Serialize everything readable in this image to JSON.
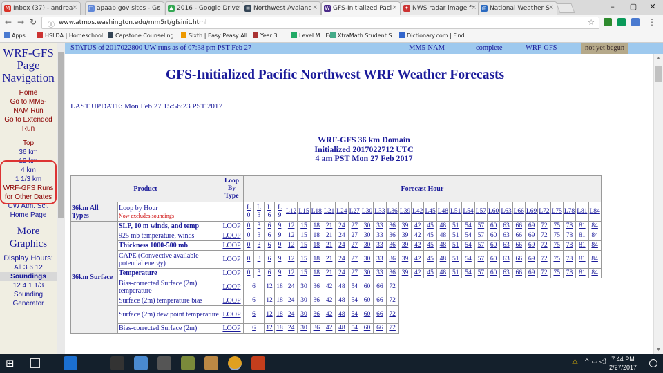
{
  "browser": {
    "tabs": [
      {
        "title": "Inbox (37) - andrea",
        "color": "#d93025",
        "glyph": "M"
      },
      {
        "title": "apaap gov sites - Go",
        "color": "#5f87d8",
        "glyph": "▢"
      },
      {
        "title": "2016 - Google Drive",
        "color": "#34a853",
        "glyph": "▲"
      },
      {
        "title": "Northwest Avalanc",
        "color": "#345",
        "glyph": "≡"
      },
      {
        "title": "GFS-Initialized Paci",
        "color": "#4a2a8a",
        "glyph": "W"
      },
      {
        "title": "NWS radar image fr",
        "color": "#c33",
        "glyph": "✦"
      },
      {
        "title": "National Weather S",
        "color": "#2a6ac0",
        "glyph": "◎"
      }
    ],
    "url": "www.atmos.washington.edu/mm5rt/gfsinit.html",
    "bookmarks": [
      "Apps",
      "HSLDA | Homeschool",
      "Capstone Counseling",
      "Sixth | Easy Peasy All",
      "Year 3",
      "Level M | Ea",
      "XtraMath  Student S",
      "Dictionary.com | Find"
    ]
  },
  "left_nav": {
    "title": "WRF-GFS Page Navigation",
    "home": "Home",
    "go_mm5": "Go to MM5-NAM Run",
    "go_extended": "Go to Extended Run",
    "top": "Top",
    "res_36": "36 km",
    "res_12": "12 km",
    "res_4": "4 km",
    "res_1": "1 1/3 km",
    "wrf_runs": "WRF-GFS Runs for Other Dates",
    "uw": "UW Atm. Sci. Home Page",
    "more_graphics": "More Graphics",
    "display_hours": "Display Hours:",
    "hours_line": "All  3  6  12",
    "soundings": "Soundings",
    "soundings_line": "12  4    1 1/3",
    "sounding_gen": "Sounding Generator"
  },
  "status": {
    "text": "STATUS of 2017022800 UW runs as of 07:38 pm PST Feb 27",
    "model1": "MM5-NAM",
    "state1": "complete",
    "model2": "WRF-GFS",
    "state2": "not yet begun"
  },
  "page_title": "GFS-Initialized Pacific Northwest WRF Weather Forecasts",
  "last_update": "LAST UPDATE: Mon Feb 27 15:56:23 PST 2017",
  "domain_header": {
    "line1": "WRF-GFS 36 km Domain",
    "line2": "Initialized 2017022712 UTC",
    "line3": "4 am PST Mon 27 Feb 2017"
  },
  "table": {
    "headers": {
      "product": "Product",
      "loop": "Loop By Type",
      "forecast": "Forecast Hour"
    },
    "loop_row": {
      "label": "36km All Types",
      "product": "Loop by Hour",
      "note": "Now excludes soundings",
      "hours": [
        "L 0",
        "L 3",
        "L 6",
        "L 9",
        "L12",
        "L15",
        "L18",
        "L21",
        "L24",
        "L27",
        "L30",
        "L33",
        "L36",
        "L39",
        "L42",
        "L45",
        "L48",
        "L51",
        "L54",
        "L57",
        "L60",
        "L63",
        "L66",
        "L69",
        "L72",
        "L75",
        "L78",
        "L81",
        "L84"
      ]
    },
    "group_label": "36km Surface",
    "rows": [
      {
        "product": "SLP, 10 m winds, and temp",
        "loop": "LOOP",
        "hours": [
          "0",
          "3",
          "6",
          "9",
          "12",
          "15",
          "18",
          "21",
          "24",
          "27",
          "30",
          "33",
          "36",
          "39",
          "42",
          "45",
          "48",
          "51",
          "54",
          "57",
          "60",
          "63",
          "66",
          "69",
          "72",
          "75",
          "78",
          "81",
          "84"
        ]
      },
      {
        "product": "925 mb temperature, winds",
        "loop": "LOOP",
        "hours": [
          "0",
          "3",
          "6",
          "9",
          "12",
          "15",
          "18",
          "21",
          "24",
          "27",
          "30",
          "33",
          "36",
          "39",
          "42",
          "45",
          "48",
          "51",
          "54",
          "57",
          "60",
          "63",
          "66",
          "69",
          "72",
          "75",
          "78",
          "81",
          "84"
        ]
      },
      {
        "product": "Thickness 1000-500 mb",
        "loop": "LOOP",
        "hours": [
          "0",
          "3",
          "6",
          "9",
          "12",
          "15",
          "18",
          "21",
          "24",
          "27",
          "30",
          "33",
          "36",
          "39",
          "42",
          "45",
          "48",
          "51",
          "54",
          "57",
          "60",
          "63",
          "66",
          "69",
          "72",
          "75",
          "78",
          "81",
          "84"
        ]
      },
      {
        "product": "CAPE (Convective available potential energy)",
        "loop": "LOOP",
        "hours": [
          "0",
          "3",
          "6",
          "9",
          "12",
          "15",
          "18",
          "21",
          "24",
          "27",
          "30",
          "33",
          "36",
          "39",
          "42",
          "45",
          "48",
          "51",
          "54",
          "57",
          "60",
          "63",
          "66",
          "69",
          "72",
          "75",
          "78",
          "81",
          "84"
        ]
      },
      {
        "product": "Temperature",
        "loop": "LOOP",
        "hours": [
          "0",
          "3",
          "6",
          "9",
          "12",
          "15",
          "18",
          "21",
          "24",
          "27",
          "30",
          "33",
          "36",
          "39",
          "42",
          "45",
          "48",
          "51",
          "54",
          "57",
          "60",
          "63",
          "66",
          "69",
          "72",
          "75",
          "78",
          "81",
          "84"
        ]
      },
      {
        "product": "Bias-corrected Surface (2m) temperature",
        "loop": "LOOP",
        "hours": [
          "6",
          "12",
          "18",
          "24",
          "30",
          "36",
          "42",
          "48",
          "54",
          "60",
          "66",
          "72"
        ]
      },
      {
        "product": "Surface (2m) temperature bias",
        "loop": "LOOP",
        "hours": [
          "6",
          "12",
          "18",
          "24",
          "30",
          "36",
          "42",
          "48",
          "54",
          "60",
          "66",
          "72"
        ]
      },
      {
        "product": "Surface (2m) dew point temperature",
        "loop": "LOOP",
        "hours": [
          "6",
          "12",
          "18",
          "24",
          "30",
          "36",
          "42",
          "48",
          "54",
          "60",
          "66",
          "72"
        ]
      },
      {
        "product": "Bias-corrected Surface (2m)",
        "loop": "LOOP",
        "hours": [
          "6",
          "12",
          "18",
          "24",
          "30",
          "36",
          "42",
          "48",
          "54",
          "60",
          "66",
          "72"
        ]
      }
    ]
  },
  "taskbar": {
    "time": "7:44 PM",
    "date": "2/27/2017"
  }
}
